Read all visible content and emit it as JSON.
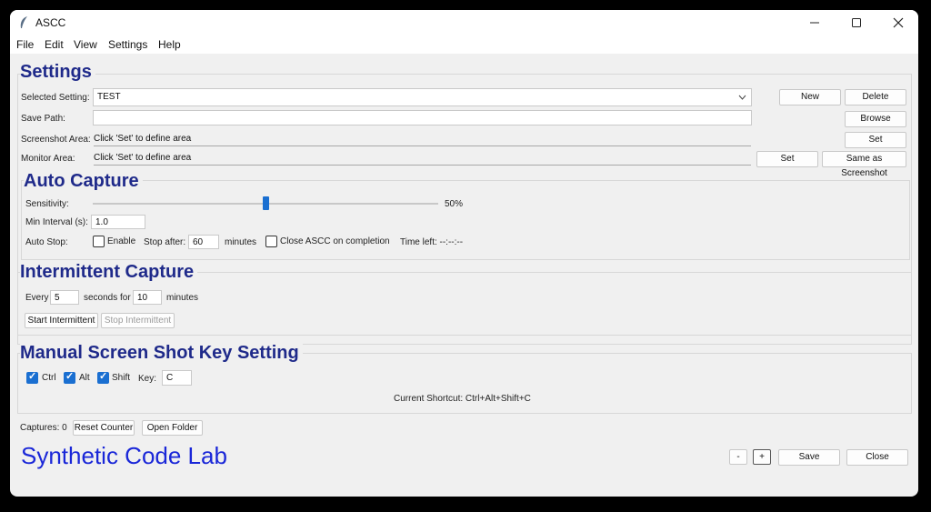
{
  "window": {
    "title": "ASCC"
  },
  "menu": [
    "File",
    "Edit",
    "View",
    "Settings",
    "Help"
  ],
  "settings": {
    "title": "Settings",
    "selected_label": "Selected Setting:",
    "selected_value": "TEST",
    "new_btn": "New",
    "delete_btn": "Delete",
    "save_path_label": "Save Path:",
    "save_path_value": "",
    "browse_btn": "Browse",
    "screenshot_label": "Screenshot Area:",
    "screenshot_value": "Click 'Set' to define area",
    "set_btn": "Set",
    "monitor_label": "Monitor Area:",
    "monitor_value": "Click 'Set' to define area",
    "monitor_set_btn": "Set",
    "same_btn": "Same as Screenshot"
  },
  "auto": {
    "title": "Auto Capture",
    "sensitivity_label": "Sensitivity:",
    "sensitivity_value": 0.5,
    "sensitivity_text": "50%",
    "min_interval_label": "Min Interval (s):",
    "min_interval_value": "1.0",
    "auto_stop_label": "Auto Stop:",
    "enable_label": "Enable",
    "stop_after_label": "Stop after:",
    "stop_after_value": "60",
    "minutes_label": "minutes",
    "close_label": "Close ASCC on completion",
    "time_left": "Time left: --:--:--"
  },
  "intermittent": {
    "title": "Intermittent Capture",
    "every_label": "Every",
    "every_value": "5",
    "seconds_for_label": "seconds for",
    "for_value": "10",
    "minutes_label": "minutes",
    "start_btn": "Start Intermittent",
    "stop_btn": "Stop Intermittent"
  },
  "manual": {
    "title": "Manual Screen Shot Key Setting",
    "ctrl_label": "Ctrl",
    "alt_label": "Alt",
    "shift_label": "Shift",
    "key_label": "Key:",
    "key_value": "C",
    "current_shortcut": "Current Shortcut: Ctrl+Alt+Shift+C"
  },
  "footer": {
    "captures": "Captures: 0",
    "reset_btn": "Reset Counter",
    "open_btn": "Open Folder",
    "brand": "Synthetic Code Lab",
    "minus_btn": "-",
    "plus_btn": "+",
    "save_btn": "Save",
    "close_btn": "Close"
  }
}
